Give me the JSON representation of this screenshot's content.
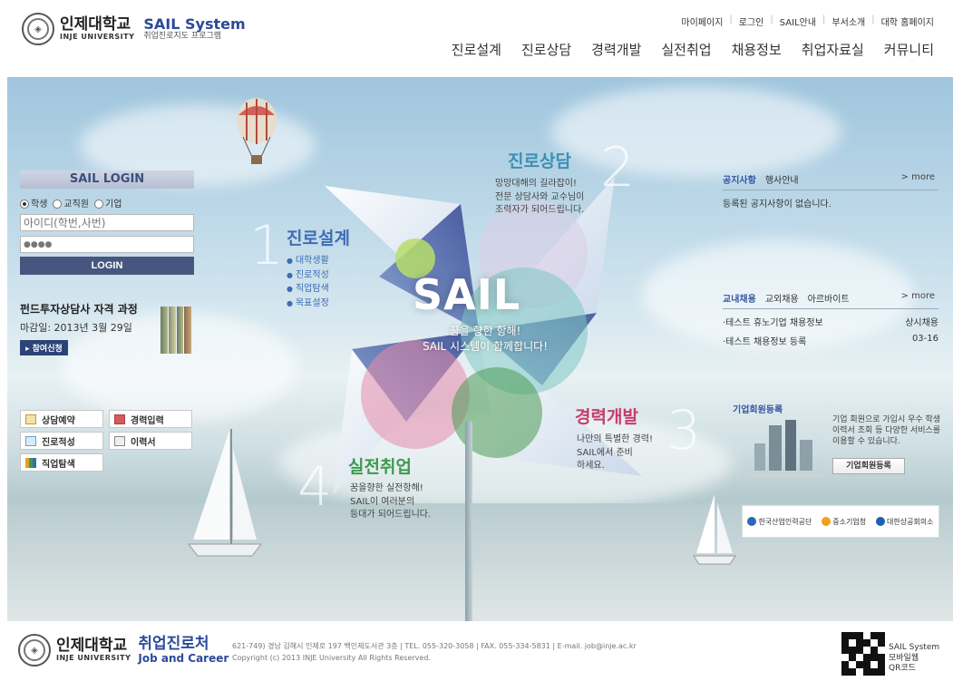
{
  "header": {
    "univ_kr": "인제대학교",
    "univ_en": "INJE UNIVERSITY",
    "system_title": "SAIL System",
    "system_sub": "취업진로지도 프로그램",
    "util_links": [
      "마이페이지",
      "로그인",
      "SAIL안내",
      "부서소개",
      "대학 홈페이지"
    ],
    "gnb": [
      "진로설계",
      "진로상담",
      "경력개발",
      "실전취업",
      "채용정보",
      "취업자료실",
      "커뮤니티"
    ]
  },
  "login": {
    "title": "SAIL LOGIN",
    "roles": [
      "학생",
      "교직원",
      "기업"
    ],
    "selected_role": "학생",
    "id_placeholder": "아이디(학번,사번)",
    "pw_value": "●●●●",
    "button": "LOGIN"
  },
  "course": {
    "title": "펀드투자상담사 자격 과정",
    "deadline": "마감일: 2013년 3월 29일",
    "apply": "▸ 참여신청"
  },
  "quick_links": [
    "상담예약",
    "경력입력",
    "진로적성",
    "이력서",
    "직업탐색"
  ],
  "features": {
    "design": {
      "num": "1",
      "title": "진로설계",
      "items": [
        "대학생활",
        "진로적성",
        "직업탐색",
        "목표설정"
      ]
    },
    "counsel": {
      "num": "2",
      "title": "진로상담",
      "desc": [
        "망망대해의 길라잡이!",
        "전문 상담사와 교수님이",
        "조력자가 되어드립니다."
      ]
    },
    "career": {
      "num": "3",
      "title": "경력개발",
      "desc": [
        "나만의 특별한 경력!",
        "SAIL에서 준비",
        "하세요."
      ]
    },
    "job": {
      "num": "4",
      "title": "실전취업",
      "desc": [
        "꿈을향한 실전항해!",
        "SAIL이 여러분의",
        "등대가 되어드립니다."
      ]
    }
  },
  "hero": {
    "big": "SAIL",
    "sub1": "꿈을 향한 항해!",
    "sub2": "SAIL 시스템이 함께합니다!"
  },
  "notice": {
    "tabs": [
      "공지사항",
      "행사안내"
    ],
    "more": "> more",
    "empty": "등록된 공지사항이 없습니다."
  },
  "jobs": {
    "tabs": [
      "교내채용",
      "교외채용",
      "아르바이트"
    ],
    "more": "> more",
    "rows": [
      {
        "title": "·테스트 휴노기업 채용정보",
        "date": "상시채용"
      },
      {
        "title": "·테스트 채용정보 등록",
        "date": "03-16"
      }
    ]
  },
  "corp": {
    "title": "기업회원등록",
    "desc": "기업 회원으로 가입시 우수 학생 이력서 조회 등 다양한 서비스를 이용할 수 있습니다.",
    "button": "기업회원등록"
  },
  "partners": [
    "한국산업인력공단",
    "중소기업청",
    "대한상공회의소"
  ],
  "footer": {
    "career_kr": "취업진로처",
    "career_en": "Job and Career",
    "address": "621-749) 경남 김해시 인제로 197 백인제도서관 3층 | TEL. 055-320-3058 | FAX. 055-334-5831 | E-mail. job@inje.ac.kr",
    "copyright": "Copyright (c) 2013 INJE University All Rights Reserved.",
    "qr1": "SAIL System",
    "qr2": "모바일웹",
    "qr3": "QR코드"
  },
  "colors": {
    "brand": "#2c4a9a",
    "login_btn": "#47567f",
    "design": "#3f6cb4",
    "counsel": "#3c8fb4",
    "career": "#c93c6c",
    "job": "#3c9a4e"
  }
}
